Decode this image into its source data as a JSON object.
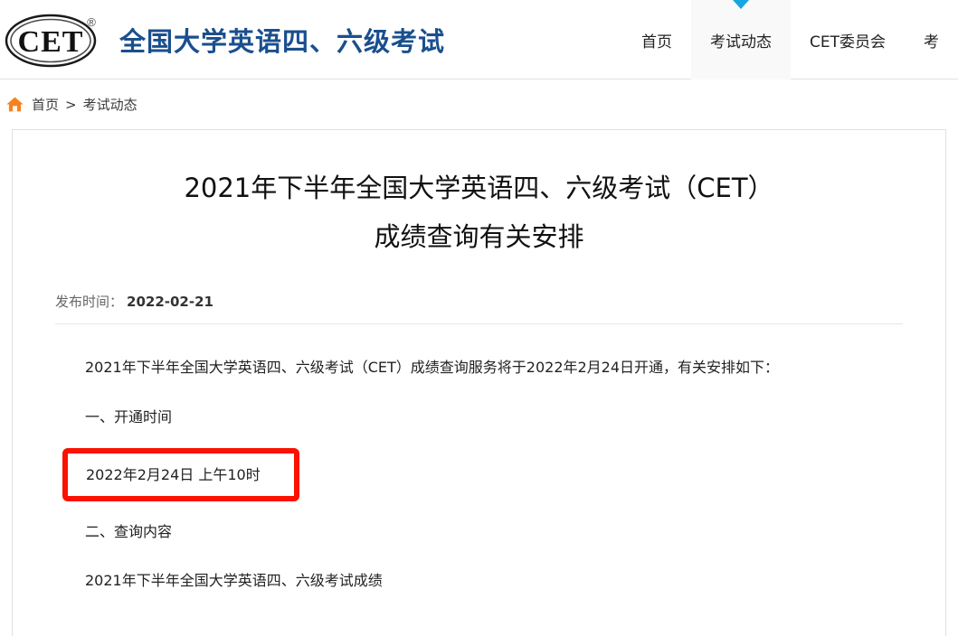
{
  "header": {
    "logo": {
      "icon": "cet-oval-logo",
      "text": "CET",
      "trademark": "®"
    },
    "brand_title": "全国大学英语四、六级考试",
    "brand_color": "#1a4f8e",
    "nav": [
      {
        "label": "首页",
        "active": false
      },
      {
        "label": "考试动态",
        "active": true
      },
      {
        "label": "CET委员会",
        "active": false
      },
      {
        "label": "考",
        "active": false
      }
    ],
    "active_marker_color": "#17a7e0"
  },
  "breadcrumb": {
    "home_icon": "home-icon",
    "home_color": "#f5821f",
    "items": [
      {
        "label": "首页"
      },
      {
        "label": "考试动态"
      }
    ],
    "separator": ">"
  },
  "article": {
    "title_line1": "2021年下半年全国大学英语四、六级考试（CET）",
    "title_line2": "成绩查询有关安排",
    "publish_label": "发布时间：",
    "publish_date": "2022-02-21",
    "paragraphs": [
      "2021年下半年全国大学英语四、六级考试（CET）成绩查询服务将于2022年2月24日开通，有关安排如下：",
      "一、开通时间"
    ],
    "highlight": {
      "text": "2022年2月24日 上午10时",
      "border_color": "#fb1100"
    },
    "paragraphs_after": [
      "二、查询内容",
      "2021年下半年全国大学英语四、六级考试成绩"
    ]
  }
}
